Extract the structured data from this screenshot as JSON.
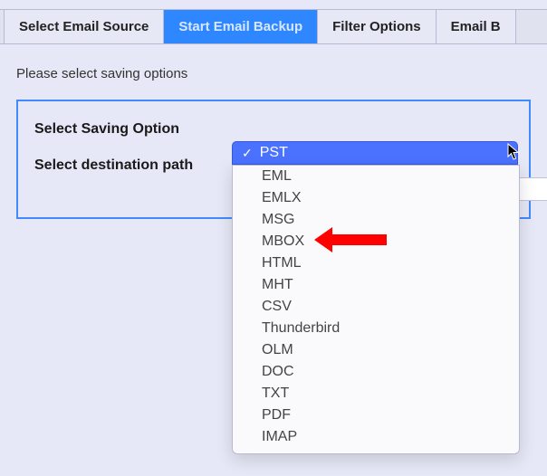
{
  "tabs": {
    "select_source": "Select Email Source",
    "start_backup": "Start Email Backup",
    "filter_options": "Filter Options",
    "email_b": "Email B"
  },
  "hint": "Please select saving options",
  "panel": {
    "saving_option_label": "Select Saving Option",
    "destination_path_label": "Select destination path"
  },
  "select": {
    "selected": "PST",
    "options": [
      "EML",
      "EMLX",
      "MSG",
      "MBOX",
      "HTML",
      "MHT",
      "CSV",
      "Thunderbird",
      "OLM",
      "DOC",
      "TXT",
      "PDF",
      "IMAP"
    ]
  }
}
